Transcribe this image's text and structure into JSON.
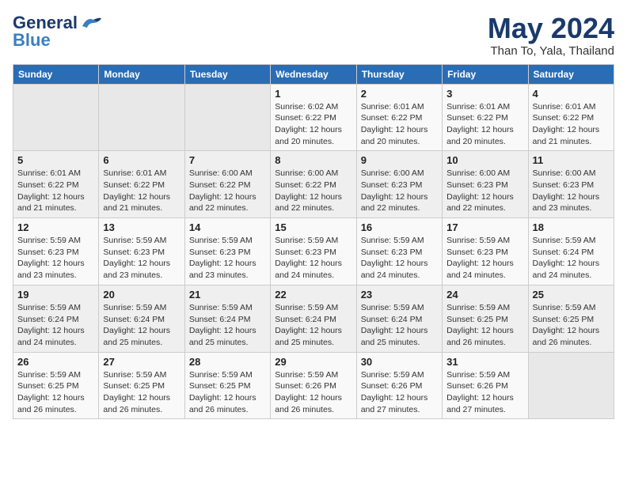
{
  "header": {
    "logo_general": "General",
    "logo_blue": "Blue",
    "title": "May 2024",
    "subtitle": "Than To, Yala, Thailand"
  },
  "calendar": {
    "days_of_week": [
      "Sunday",
      "Monday",
      "Tuesday",
      "Wednesday",
      "Thursday",
      "Friday",
      "Saturday"
    ],
    "weeks": [
      [
        {
          "day": "",
          "info": ""
        },
        {
          "day": "",
          "info": ""
        },
        {
          "day": "",
          "info": ""
        },
        {
          "day": "1",
          "info": "Sunrise: 6:02 AM\nSunset: 6:22 PM\nDaylight: 12 hours\nand 20 minutes."
        },
        {
          "day": "2",
          "info": "Sunrise: 6:01 AM\nSunset: 6:22 PM\nDaylight: 12 hours\nand 20 minutes."
        },
        {
          "day": "3",
          "info": "Sunrise: 6:01 AM\nSunset: 6:22 PM\nDaylight: 12 hours\nand 20 minutes."
        },
        {
          "day": "4",
          "info": "Sunrise: 6:01 AM\nSunset: 6:22 PM\nDaylight: 12 hours\nand 21 minutes."
        }
      ],
      [
        {
          "day": "5",
          "info": "Sunrise: 6:01 AM\nSunset: 6:22 PM\nDaylight: 12 hours\nand 21 minutes."
        },
        {
          "day": "6",
          "info": "Sunrise: 6:01 AM\nSunset: 6:22 PM\nDaylight: 12 hours\nand 21 minutes."
        },
        {
          "day": "7",
          "info": "Sunrise: 6:00 AM\nSunset: 6:22 PM\nDaylight: 12 hours\nand 22 minutes."
        },
        {
          "day": "8",
          "info": "Sunrise: 6:00 AM\nSunset: 6:22 PM\nDaylight: 12 hours\nand 22 minutes."
        },
        {
          "day": "9",
          "info": "Sunrise: 6:00 AM\nSunset: 6:23 PM\nDaylight: 12 hours\nand 22 minutes."
        },
        {
          "day": "10",
          "info": "Sunrise: 6:00 AM\nSunset: 6:23 PM\nDaylight: 12 hours\nand 22 minutes."
        },
        {
          "day": "11",
          "info": "Sunrise: 6:00 AM\nSunset: 6:23 PM\nDaylight: 12 hours\nand 23 minutes."
        }
      ],
      [
        {
          "day": "12",
          "info": "Sunrise: 5:59 AM\nSunset: 6:23 PM\nDaylight: 12 hours\nand 23 minutes."
        },
        {
          "day": "13",
          "info": "Sunrise: 5:59 AM\nSunset: 6:23 PM\nDaylight: 12 hours\nand 23 minutes."
        },
        {
          "day": "14",
          "info": "Sunrise: 5:59 AM\nSunset: 6:23 PM\nDaylight: 12 hours\nand 23 minutes."
        },
        {
          "day": "15",
          "info": "Sunrise: 5:59 AM\nSunset: 6:23 PM\nDaylight: 12 hours\nand 24 minutes."
        },
        {
          "day": "16",
          "info": "Sunrise: 5:59 AM\nSunset: 6:23 PM\nDaylight: 12 hours\nand 24 minutes."
        },
        {
          "day": "17",
          "info": "Sunrise: 5:59 AM\nSunset: 6:23 PM\nDaylight: 12 hours\nand 24 minutes."
        },
        {
          "day": "18",
          "info": "Sunrise: 5:59 AM\nSunset: 6:24 PM\nDaylight: 12 hours\nand 24 minutes."
        }
      ],
      [
        {
          "day": "19",
          "info": "Sunrise: 5:59 AM\nSunset: 6:24 PM\nDaylight: 12 hours\nand 24 minutes."
        },
        {
          "day": "20",
          "info": "Sunrise: 5:59 AM\nSunset: 6:24 PM\nDaylight: 12 hours\nand 25 minutes."
        },
        {
          "day": "21",
          "info": "Sunrise: 5:59 AM\nSunset: 6:24 PM\nDaylight: 12 hours\nand 25 minutes."
        },
        {
          "day": "22",
          "info": "Sunrise: 5:59 AM\nSunset: 6:24 PM\nDaylight: 12 hours\nand 25 minutes."
        },
        {
          "day": "23",
          "info": "Sunrise: 5:59 AM\nSunset: 6:24 PM\nDaylight: 12 hours\nand 25 minutes."
        },
        {
          "day": "24",
          "info": "Sunrise: 5:59 AM\nSunset: 6:25 PM\nDaylight: 12 hours\nand 26 minutes."
        },
        {
          "day": "25",
          "info": "Sunrise: 5:59 AM\nSunset: 6:25 PM\nDaylight: 12 hours\nand 26 minutes."
        }
      ],
      [
        {
          "day": "26",
          "info": "Sunrise: 5:59 AM\nSunset: 6:25 PM\nDaylight: 12 hours\nand 26 minutes."
        },
        {
          "day": "27",
          "info": "Sunrise: 5:59 AM\nSunset: 6:25 PM\nDaylight: 12 hours\nand 26 minutes."
        },
        {
          "day": "28",
          "info": "Sunrise: 5:59 AM\nSunset: 6:25 PM\nDaylight: 12 hours\nand 26 minutes."
        },
        {
          "day": "29",
          "info": "Sunrise: 5:59 AM\nSunset: 6:26 PM\nDaylight: 12 hours\nand 26 minutes."
        },
        {
          "day": "30",
          "info": "Sunrise: 5:59 AM\nSunset: 6:26 PM\nDaylight: 12 hours\nand 27 minutes."
        },
        {
          "day": "31",
          "info": "Sunrise: 5:59 AM\nSunset: 6:26 PM\nDaylight: 12 hours\nand 27 minutes."
        },
        {
          "day": "",
          "info": ""
        }
      ]
    ]
  }
}
